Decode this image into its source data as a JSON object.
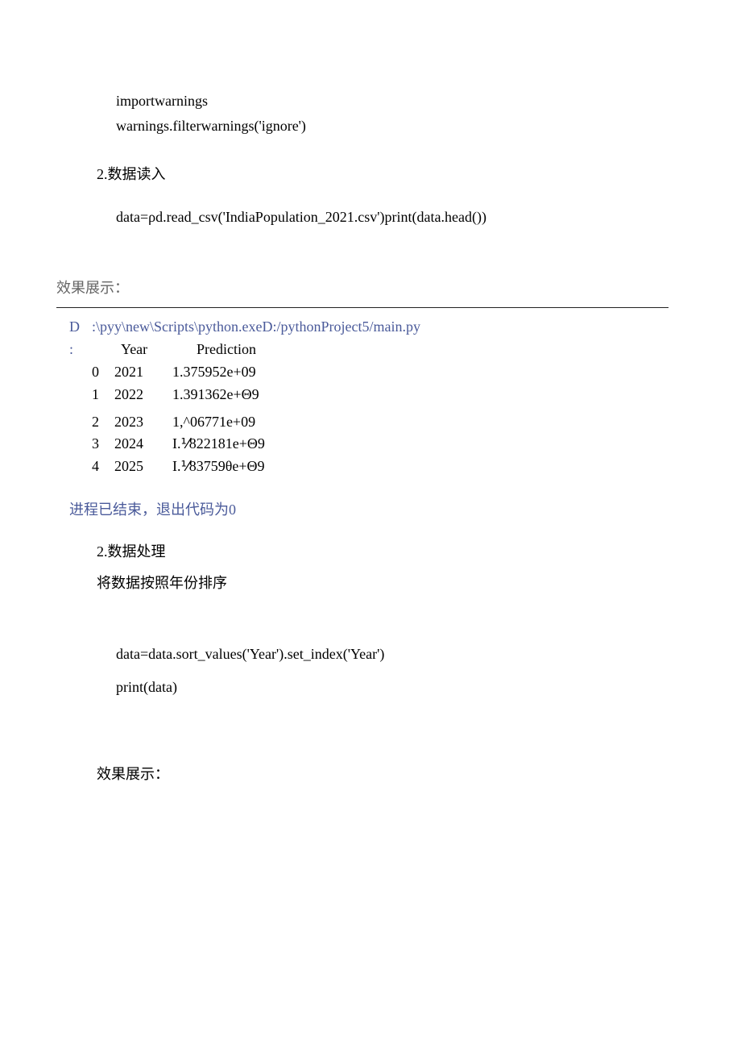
{
  "code1": {
    "line1": "importwarnings",
    "line2": "warnings.filterwarnings('ignore')"
  },
  "section1": {
    "title": "2.数据读入",
    "code": "data=ρd.read_csv('IndiaPopulation_2021.csv')print(data.head())"
  },
  "result_label": "效果展示：",
  "console": {
    "d_marker": "D",
    "colon_marker": ":",
    "path": ":\\pyy\\new\\Scripts\\python.exeD:/pythonProject5/main.py",
    "hdr_year": "Year",
    "hdr_pred": "Prediction",
    "rows": [
      {
        "idx": "0",
        "year": "2021",
        "pred": "1.375952e+09"
      },
      {
        "idx": "1",
        "year": "2022",
        "pred": "1.391362e+Θ9"
      },
      {
        "idx": "2",
        "year": "2023",
        "pred": "1,^06771e+09"
      },
      {
        "idx": "3",
        "year": "2024",
        "pred": "I.⅟822181e+Θ9"
      },
      {
        "idx": "4",
        "year": "2025",
        "pred": "I.⅟83759θe+Θ9"
      }
    ],
    "exit_line": "进程已结束，退出代码为0"
  },
  "section2": {
    "title": "2.数据处理",
    "subtitle": "将数据按照年份排序"
  },
  "code2": {
    "line1": "data=data.sort_values('Year').set_index('Year')",
    "line2": "print(data)"
  },
  "result_label2": "效果展示："
}
